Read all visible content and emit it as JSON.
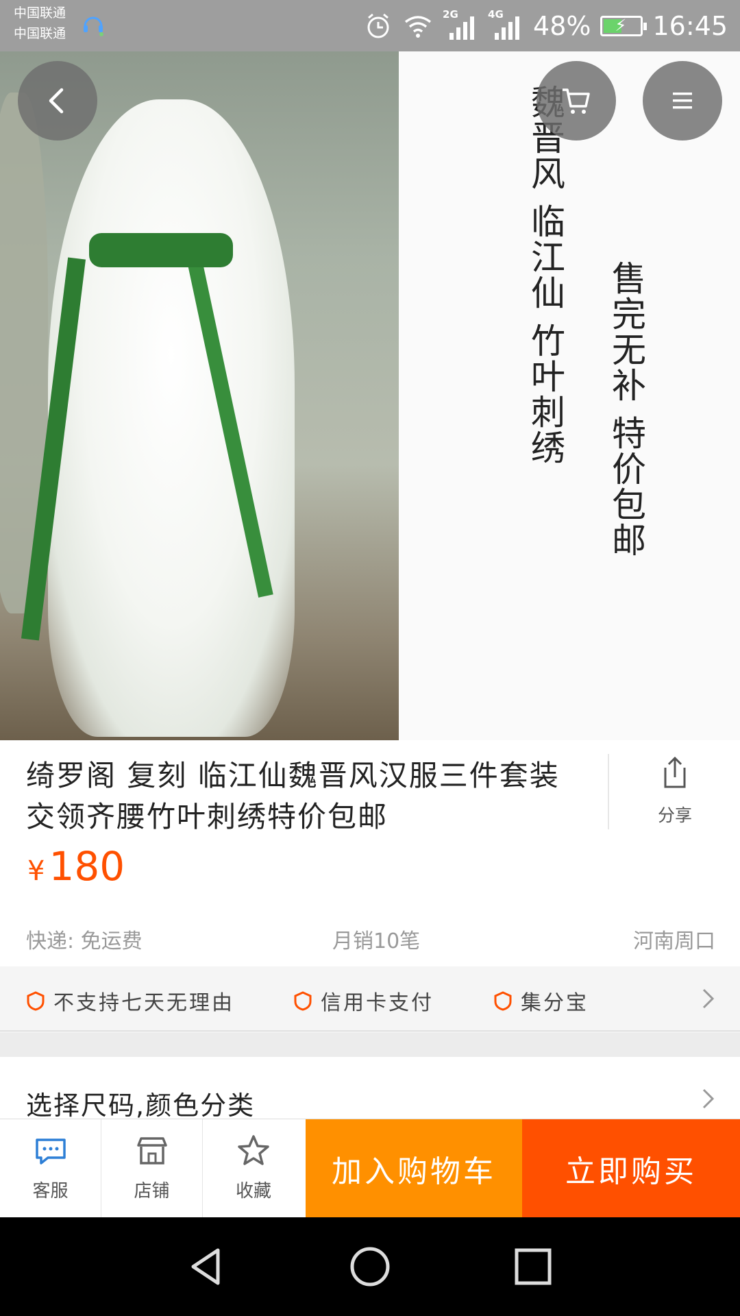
{
  "status_bar": {
    "carrier_1": "中国联通",
    "carrier_2": "中国联通",
    "network_1": "2G",
    "network_2": "4G",
    "battery": "48%",
    "time": "16:45"
  },
  "gallery": {
    "overlay_text_1": "魏晋风 临江仙 竹叶刺绣",
    "overlay_text_2": "售完无补 特价包邮"
  },
  "product": {
    "title": "绮罗阁 复刻 临江仙魏晋风汉服三件套装交领齐腰竹叶刺绣特价包邮",
    "currency": "¥",
    "price": "180",
    "share_label": "分享",
    "shipping": "快递: 免运费",
    "monthly_sales": "月销10笔",
    "location": "河南周口"
  },
  "services": {
    "items": [
      "不支持七天无理由",
      "信用卡支付",
      "集分宝"
    ]
  },
  "sku": {
    "label": "选择尺码,颜色分类"
  },
  "action_bar": {
    "service_label": "客服",
    "shop_label": "店铺",
    "favorite_label": "收藏",
    "add_to_cart_label": "加入购物车",
    "buy_now_label": "立即购买"
  },
  "colors": {
    "price": "#ff5000",
    "cart_button": "#ff9000",
    "buy_button": "#ff5000",
    "accent": "#2d7fd6"
  }
}
